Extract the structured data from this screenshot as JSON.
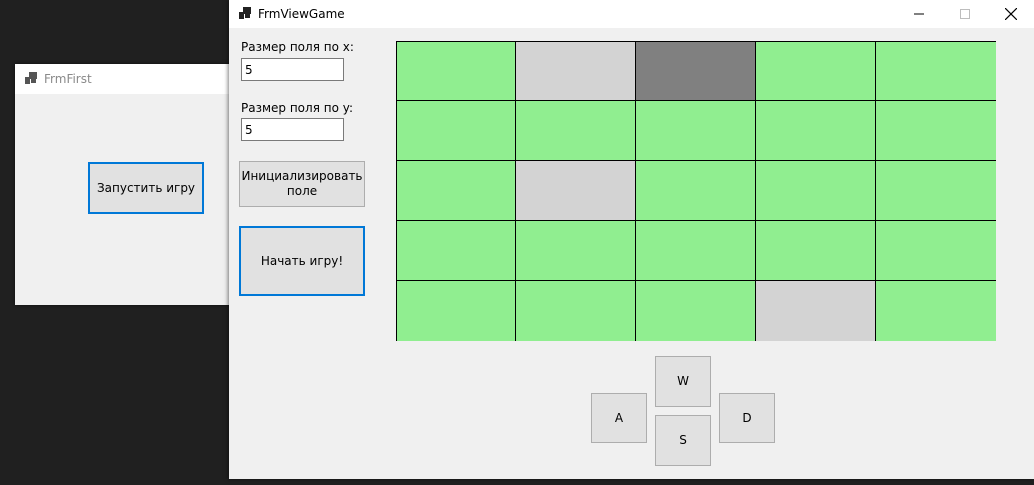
{
  "first_window": {
    "title": "FrmFirst",
    "start_button_label": "Запустить игру"
  },
  "game_window": {
    "title": "FrmViewGame",
    "size_x_label": "Размер поля по x:",
    "size_x_value": "5",
    "size_y_label": "Размер поля по y:",
    "size_y_value": "5",
    "init_button_label": "Инициализировать поле",
    "begin_button_label": "Начать игру!",
    "controls": {
      "up": "W",
      "left": "A",
      "down": "S",
      "right": "D"
    }
  },
  "grid": {
    "columns": 5,
    "rows": 5,
    "cells": [
      [
        "green",
        "light-gray",
        "dark-gray",
        "green",
        "green"
      ],
      [
        "green",
        "green",
        "green",
        "green",
        "green"
      ],
      [
        "green",
        "light-gray",
        "green",
        "green",
        "green"
      ],
      [
        "green",
        "green",
        "green",
        "green",
        "green"
      ],
      [
        "green",
        "green",
        "green",
        "light-gray",
        "green"
      ]
    ],
    "colors": {
      "green": "#90ee90",
      "light-gray": "#d3d3d3",
      "dark-gray": "#808080"
    }
  },
  "icons": {
    "app": "app-windows-icon",
    "minimize": "minimize-icon",
    "maximize": "maximize-icon",
    "close": "close-icon"
  }
}
